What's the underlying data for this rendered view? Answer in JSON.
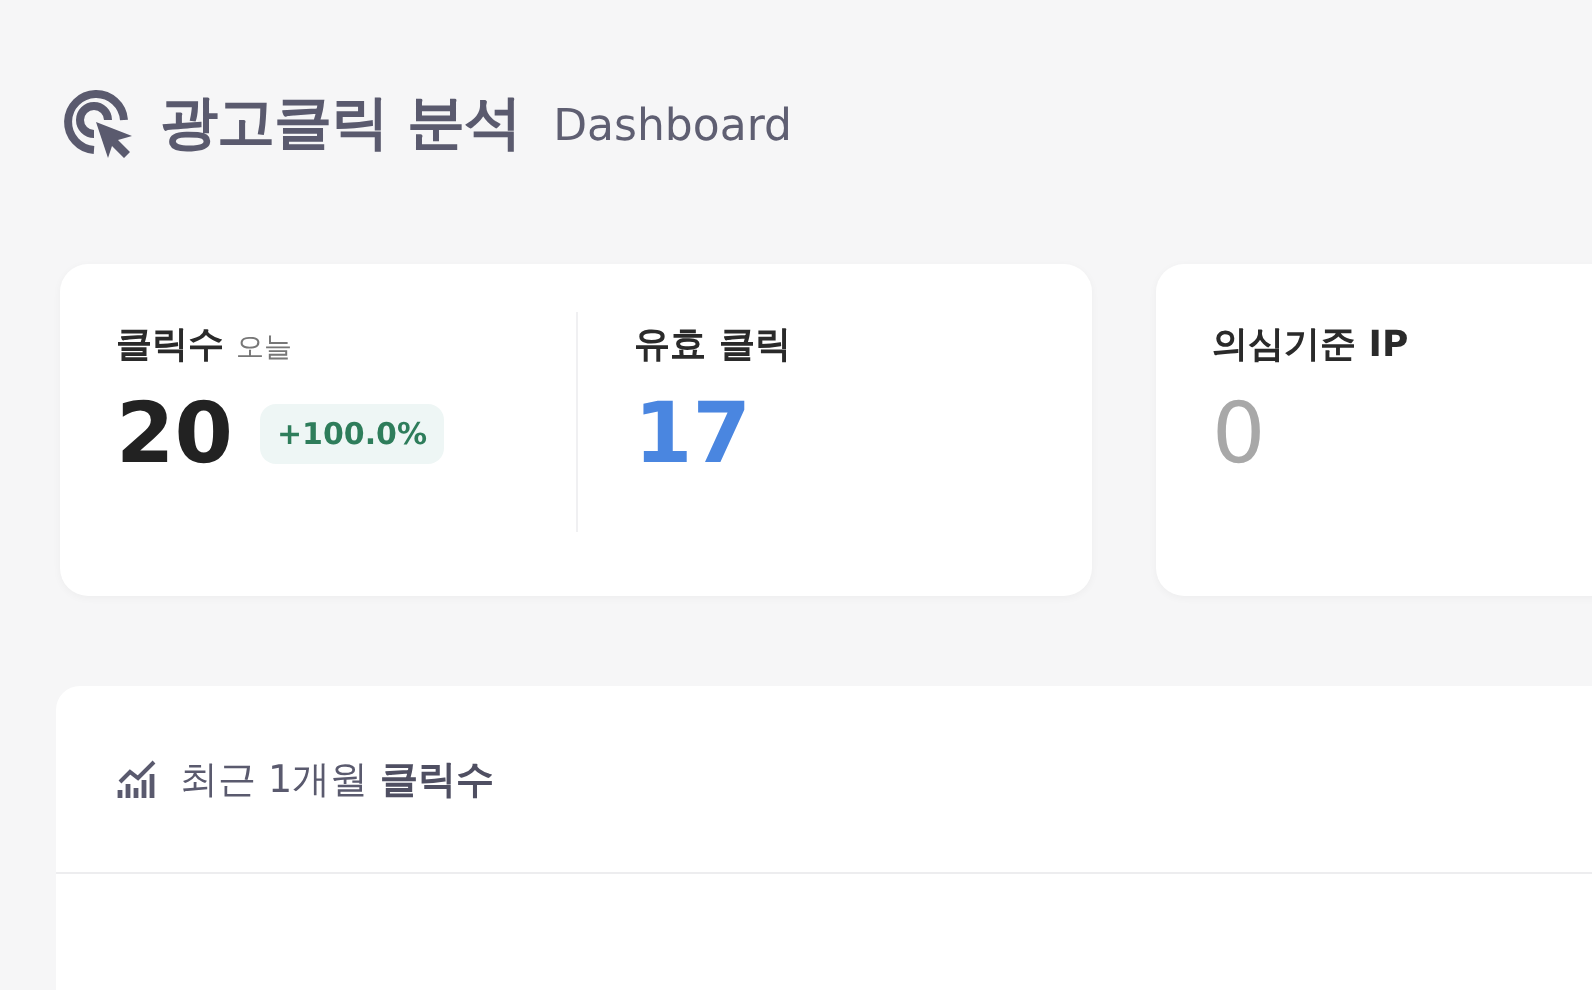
{
  "header": {
    "title": "광고클릭 분석",
    "subtitle": "Dashboard"
  },
  "stat_cards": [
    {
      "stats": [
        {
          "label": "클릭수",
          "sublabel": "오늘",
          "value": "20",
          "color": "#222222",
          "badge": "+100.0%"
        },
        {
          "label": "유효 클릭",
          "value": "17",
          "color": "#4a86e0"
        }
      ]
    },
    {
      "stats": [
        {
          "label": "의심기준 IP",
          "value": "0",
          "color": "#a8a8a8"
        }
      ]
    }
  ],
  "chart_panel": {
    "title": "최근 1개월 **클릭수**"
  }
}
